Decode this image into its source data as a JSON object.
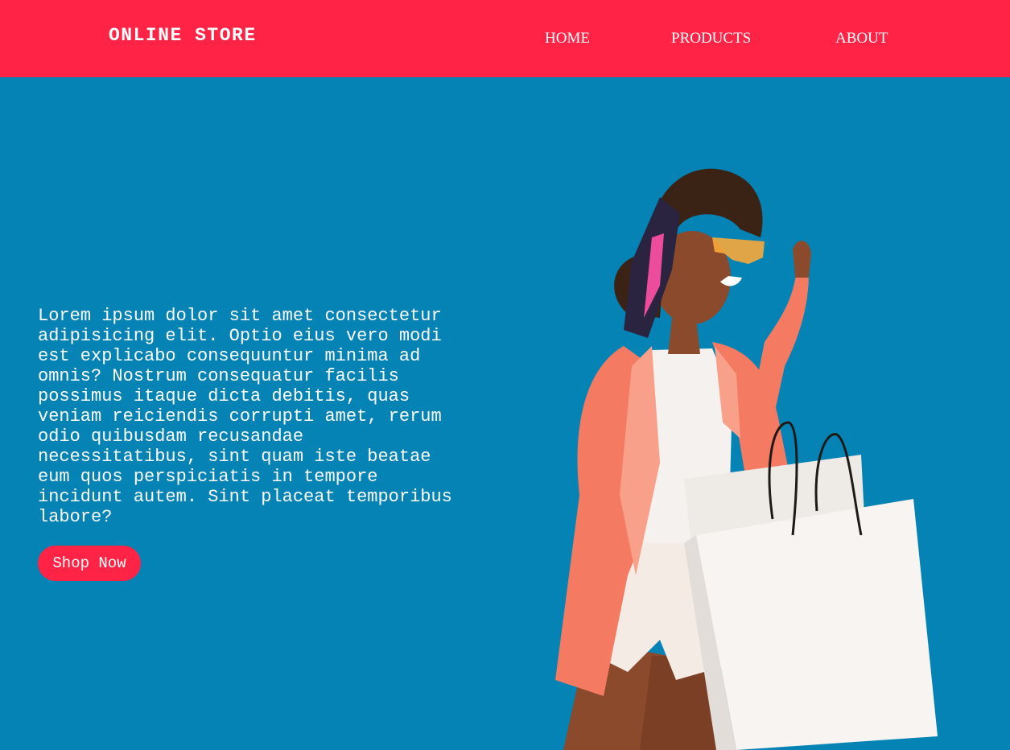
{
  "header": {
    "brand": "ONLINE STORE",
    "nav": {
      "home": "HOME",
      "products": "PRODUCTS",
      "about": "ABOUT"
    }
  },
  "hero": {
    "text": "Lorem ipsum dolor sit amet consectetur adipisicing elit. Optio eius vero modi est explicabo consequuntur minima ad omnis? Nostrum consequatur facilis possimus itaque dicta debitis, quas veniam reiciendis corrupti amet, rerum odio quibusdam recusandae necessitatibus, sint quam iste beatae eum quos perspiciatis in tempore incidunt autem. Sint placeat temporibus labore?",
    "button_label": "Shop Now",
    "image_subject": "woman-holding-shopping-bags"
  },
  "colors": {
    "header_bg": "#ff2346",
    "page_bg": "#0583b5",
    "button_bg": "#ff2346",
    "text": "#ffffff"
  }
}
